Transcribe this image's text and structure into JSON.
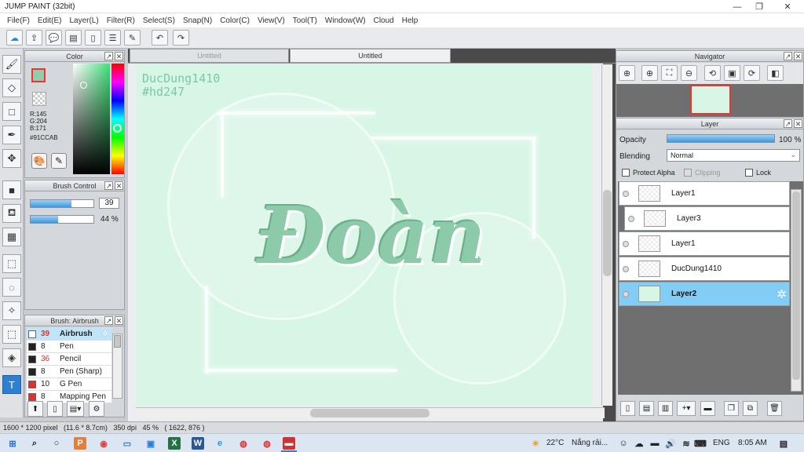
{
  "window": {
    "title": "JUMP PAINT (32bit)",
    "min": "—",
    "max": "❐",
    "close": "✕"
  },
  "menu": [
    "File(F)",
    "Edit(E)",
    "Layer(L)",
    "Filter(R)",
    "Select(S)",
    "Snap(N)",
    "Color(C)",
    "View(V)",
    "Tool(T)",
    "Window(W)",
    "Cloud",
    "Help"
  ],
  "tabs": [
    {
      "label": "Untitled"
    },
    {
      "label": "Untitled"
    }
  ],
  "color_panel": {
    "title": "Color",
    "r": "R:145",
    "g": "G:204",
    "b": "B:171",
    "hex": "#91CCAB",
    "fg_color": "#91CCAB"
  },
  "brush_control": {
    "title": "Brush Control",
    "size": "39",
    "size_fraction": 0.65,
    "opacity": "44 %",
    "opacity_fraction": 0.44
  },
  "brush_list": {
    "title": "Brush: Airbrush",
    "items": [
      {
        "size": "39",
        "name": "Airbrush",
        "color": "#ffffff",
        "red_size": true
      },
      {
        "size": "8",
        "name": "Pen",
        "color": "#222222",
        "red_size": false
      },
      {
        "size": "36",
        "name": "Pencil",
        "color": "#222222",
        "red_size": true
      },
      {
        "size": "8",
        "name": "Pen (Sharp)",
        "color": "#222222",
        "red_size": false
      },
      {
        "size": "10",
        "name": "G Pen",
        "color": "#e03030",
        "red_size": false
      },
      {
        "size": "8",
        "name": "Mapping Pen",
        "color": "#e03030",
        "red_size": false
      }
    ]
  },
  "canvas": {
    "watermark": "DucDung1410\n#hd247",
    "art_text": "Đoàn",
    "bg_color": "#d8f6e6"
  },
  "navigator": {
    "title": "Navigator"
  },
  "layer_panel": {
    "title": "Layer",
    "opacity_label": "Opacity",
    "opacity_value": "100 %",
    "blending_label": "Blending",
    "blending_value": "Normal",
    "protect_alpha": "Protect Alpha",
    "clipping": "Clipping",
    "lock": "Lock",
    "layers": [
      {
        "name": "Layer1",
        "selected": false,
        "indent": false
      },
      {
        "name": "Layer3",
        "selected": false,
        "indent": true
      },
      {
        "name": "Layer1",
        "selected": false,
        "indent": false
      },
      {
        "name": "DucDung1410",
        "selected": false,
        "indent": false
      },
      {
        "name": "Layer2",
        "selected": true,
        "indent": false
      }
    ]
  },
  "status": {
    "text": "1600 * 1200 pixel   (11.6 * 8.7cm)   350 dpi   45 %   ( 1622, 876 )"
  },
  "taskbar": {
    "temp": "22°C",
    "weather": "Nắng rải...",
    "lang": "ENG",
    "time": "8:05 AM"
  }
}
